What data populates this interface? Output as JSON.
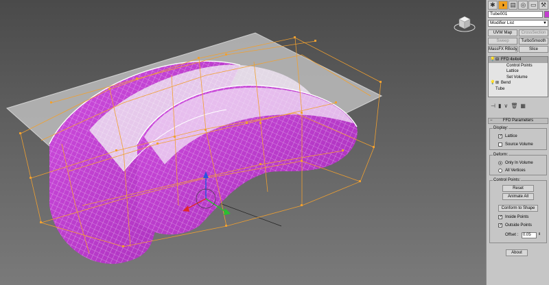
{
  "command_panel": {
    "tabs": [
      {
        "icon": "create-icon",
        "glyph": "✱"
      },
      {
        "icon": "modify-icon",
        "glyph": "◑"
      },
      {
        "icon": "hierarchy-icon",
        "glyph": "▤"
      },
      {
        "icon": "motion-icon",
        "glyph": "◎"
      },
      {
        "icon": "display-icon",
        "glyph": "▭"
      },
      {
        "icon": "utilities-icon",
        "glyph": "⚒"
      }
    ],
    "object_name": "Tube001",
    "object_color": "#c33fd0",
    "modifier_list": "Modifier List",
    "modifier_buttons": [
      [
        "UVW Map",
        "CrossSection"
      ],
      [
        "Sweep",
        "TurboSmooth"
      ],
      [
        "MassFX RBody",
        "Slice"
      ]
    ],
    "stack": {
      "ffd": "FFD 4x4x4",
      "control_points": "Control Points",
      "lattice": "Lattice",
      "set_volume": "Set Volume",
      "bend": "Bend",
      "tube": "Tube"
    }
  },
  "ffd_parameters": {
    "title": "FFD Parameters",
    "display": {
      "title": "Display:",
      "lattice": "Lattice",
      "lattice_checked": true,
      "source_volume": "Source Volume",
      "source_volume_checked": false
    },
    "deform": {
      "title": "Deform:",
      "only_in_volume": "Only In Volume",
      "all_vertices": "All Vertices",
      "selected": "only_in_volume"
    },
    "control_points": {
      "title": "Control Points:",
      "reset": "Reset",
      "animate_all": "Animate All",
      "conform_to_shape": "Conform to Shape",
      "inside_points": "Inside Points",
      "inside_checked": true,
      "outside_points": "Outside Points",
      "outside_checked": true,
      "offset_label": "Offset :",
      "offset_value": "0.05"
    },
    "about": "About"
  },
  "colors": {
    "accent_tab": "#f0a020",
    "lattice": "#f0a030",
    "surface": "#c33fd0",
    "plane": "#bdbdbd"
  }
}
